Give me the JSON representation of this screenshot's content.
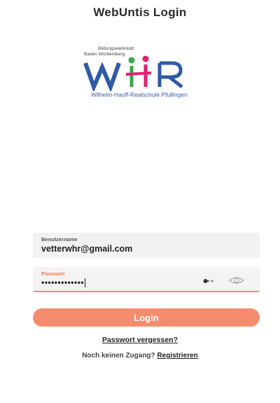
{
  "header": {
    "title": "WebUntis Login"
  },
  "logo": {
    "org_line1": "Bildungswerkstatt",
    "org_line2": "Baden Württemberg",
    "mark": "WHR",
    "school_name": "Wilhelm-Hauff-Realschule Pfullingen",
    "colors": {
      "blue": "#2f5aa6",
      "green": "#3aa84a",
      "pink": "#e4206f"
    }
  },
  "form": {
    "username": {
      "label": "Benutzername",
      "value": "vetterwhr@gmail.com"
    },
    "password": {
      "label": "Passwort",
      "value": "•••••••••••••",
      "key_icon": "key-icon",
      "visibility_icon": "eye-icon"
    },
    "login_label": "Login",
    "forgot_label": "Passwort vergessen?",
    "no_access_text": "Noch keinen Zugang?",
    "register_label": "Registrieren"
  },
  "colors": {
    "accent": "#f58c6d",
    "field_bg": "#f2f2f2"
  }
}
